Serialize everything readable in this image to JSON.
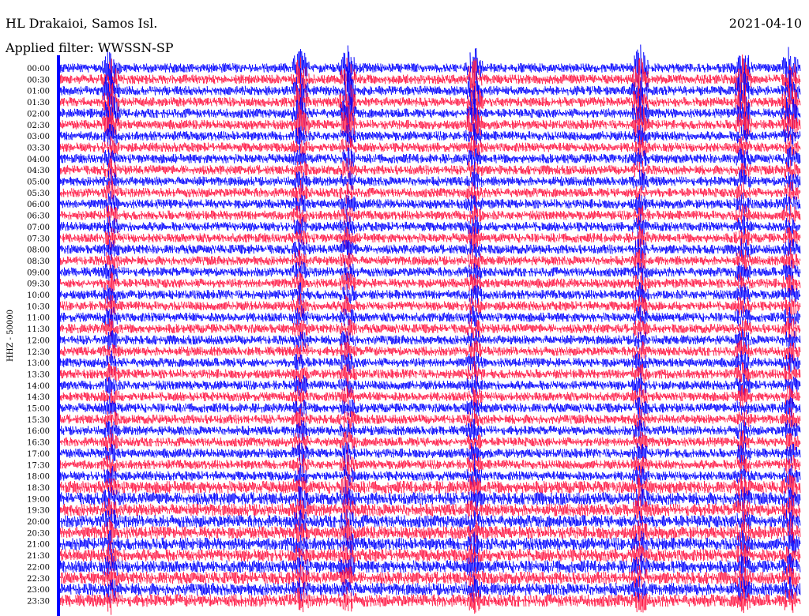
{
  "header": {
    "station": "HL Drakaioi, Samos Isl.",
    "date": "2021-04-10",
    "filter": "Applied filter: WWSSN-SP"
  },
  "chart_data": {
    "type": "line",
    "title": "HL Drakaioi, Samos Isl.",
    "ylabel": "HHZ - 50000",
    "row_labels": [
      "00:00",
      "00:30",
      "01:00",
      "01:30",
      "02:00",
      "02:30",
      "03:00",
      "03:30",
      "04:00",
      "04:30",
      "05:00",
      "05:30",
      "06:00",
      "06:30",
      "07:00",
      "07:30",
      "08:00",
      "08:30",
      "09:00",
      "09:30",
      "10:00",
      "10:30",
      "11:00",
      "11:30",
      "12:00",
      "12:30",
      "13:00",
      "13:30",
      "14:00",
      "14:30",
      "15:00",
      "15:30",
      "16:00",
      "16:30",
      "17:00",
      "17:30",
      "18:00",
      "18:30",
      "19:00",
      "19:30",
      "20:00",
      "20:30",
      "21:00",
      "21:30",
      "22:00",
      "22:30",
      "23:00",
      "23:30"
    ],
    "series_colors": [
      "#0000ff",
      "#ff1744"
    ],
    "grid": false
  }
}
